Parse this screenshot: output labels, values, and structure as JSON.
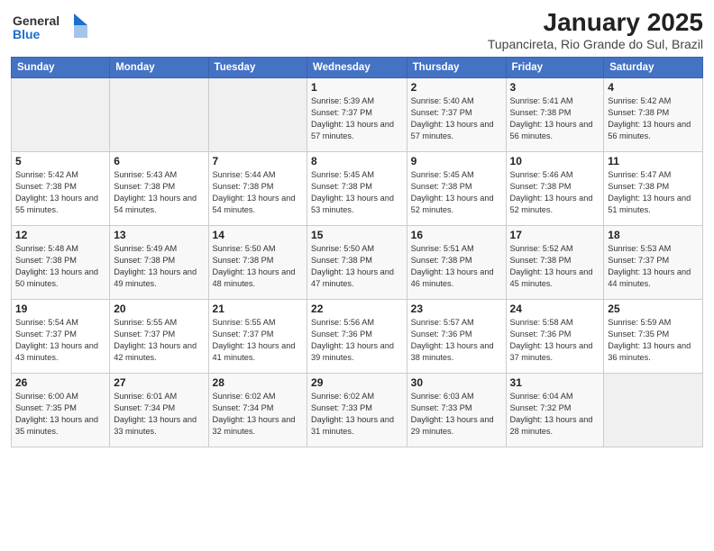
{
  "logo": {
    "general": "General",
    "blue": "Blue"
  },
  "header": {
    "title": "January 2025",
    "subtitle": "Tupancireta, Rio Grande do Sul, Brazil"
  },
  "weekdays": [
    "Sunday",
    "Monday",
    "Tuesday",
    "Wednesday",
    "Thursday",
    "Friday",
    "Saturday"
  ],
  "weeks": [
    [
      {
        "day": "",
        "content": ""
      },
      {
        "day": "",
        "content": ""
      },
      {
        "day": "",
        "content": ""
      },
      {
        "day": "1",
        "content": "Sunrise: 5:39 AM\nSunset: 7:37 PM\nDaylight: 13 hours\nand 57 minutes."
      },
      {
        "day": "2",
        "content": "Sunrise: 5:40 AM\nSunset: 7:37 PM\nDaylight: 13 hours\nand 57 minutes."
      },
      {
        "day": "3",
        "content": "Sunrise: 5:41 AM\nSunset: 7:38 PM\nDaylight: 13 hours\nand 56 minutes."
      },
      {
        "day": "4",
        "content": "Sunrise: 5:42 AM\nSunset: 7:38 PM\nDaylight: 13 hours\nand 56 minutes."
      }
    ],
    [
      {
        "day": "5",
        "content": "Sunrise: 5:42 AM\nSunset: 7:38 PM\nDaylight: 13 hours\nand 55 minutes."
      },
      {
        "day": "6",
        "content": "Sunrise: 5:43 AM\nSunset: 7:38 PM\nDaylight: 13 hours\nand 54 minutes."
      },
      {
        "day": "7",
        "content": "Sunrise: 5:44 AM\nSunset: 7:38 PM\nDaylight: 13 hours\nand 54 minutes."
      },
      {
        "day": "8",
        "content": "Sunrise: 5:45 AM\nSunset: 7:38 PM\nDaylight: 13 hours\nand 53 minutes."
      },
      {
        "day": "9",
        "content": "Sunrise: 5:45 AM\nSunset: 7:38 PM\nDaylight: 13 hours\nand 52 minutes."
      },
      {
        "day": "10",
        "content": "Sunrise: 5:46 AM\nSunset: 7:38 PM\nDaylight: 13 hours\nand 52 minutes."
      },
      {
        "day": "11",
        "content": "Sunrise: 5:47 AM\nSunset: 7:38 PM\nDaylight: 13 hours\nand 51 minutes."
      }
    ],
    [
      {
        "day": "12",
        "content": "Sunrise: 5:48 AM\nSunset: 7:38 PM\nDaylight: 13 hours\nand 50 minutes."
      },
      {
        "day": "13",
        "content": "Sunrise: 5:49 AM\nSunset: 7:38 PM\nDaylight: 13 hours\nand 49 minutes."
      },
      {
        "day": "14",
        "content": "Sunrise: 5:50 AM\nSunset: 7:38 PM\nDaylight: 13 hours\nand 48 minutes."
      },
      {
        "day": "15",
        "content": "Sunrise: 5:50 AM\nSunset: 7:38 PM\nDaylight: 13 hours\nand 47 minutes."
      },
      {
        "day": "16",
        "content": "Sunrise: 5:51 AM\nSunset: 7:38 PM\nDaylight: 13 hours\nand 46 minutes."
      },
      {
        "day": "17",
        "content": "Sunrise: 5:52 AM\nSunset: 7:38 PM\nDaylight: 13 hours\nand 45 minutes."
      },
      {
        "day": "18",
        "content": "Sunrise: 5:53 AM\nSunset: 7:37 PM\nDaylight: 13 hours\nand 44 minutes."
      }
    ],
    [
      {
        "day": "19",
        "content": "Sunrise: 5:54 AM\nSunset: 7:37 PM\nDaylight: 13 hours\nand 43 minutes."
      },
      {
        "day": "20",
        "content": "Sunrise: 5:55 AM\nSunset: 7:37 PM\nDaylight: 13 hours\nand 42 minutes."
      },
      {
        "day": "21",
        "content": "Sunrise: 5:55 AM\nSunset: 7:37 PM\nDaylight: 13 hours\nand 41 minutes."
      },
      {
        "day": "22",
        "content": "Sunrise: 5:56 AM\nSunset: 7:36 PM\nDaylight: 13 hours\nand 39 minutes."
      },
      {
        "day": "23",
        "content": "Sunrise: 5:57 AM\nSunset: 7:36 PM\nDaylight: 13 hours\nand 38 minutes."
      },
      {
        "day": "24",
        "content": "Sunrise: 5:58 AM\nSunset: 7:36 PM\nDaylight: 13 hours\nand 37 minutes."
      },
      {
        "day": "25",
        "content": "Sunrise: 5:59 AM\nSunset: 7:35 PM\nDaylight: 13 hours\nand 36 minutes."
      }
    ],
    [
      {
        "day": "26",
        "content": "Sunrise: 6:00 AM\nSunset: 7:35 PM\nDaylight: 13 hours\nand 35 minutes."
      },
      {
        "day": "27",
        "content": "Sunrise: 6:01 AM\nSunset: 7:34 PM\nDaylight: 13 hours\nand 33 minutes."
      },
      {
        "day": "28",
        "content": "Sunrise: 6:02 AM\nSunset: 7:34 PM\nDaylight: 13 hours\nand 32 minutes."
      },
      {
        "day": "29",
        "content": "Sunrise: 6:02 AM\nSunset: 7:33 PM\nDaylight: 13 hours\nand 31 minutes."
      },
      {
        "day": "30",
        "content": "Sunrise: 6:03 AM\nSunset: 7:33 PM\nDaylight: 13 hours\nand 29 minutes."
      },
      {
        "day": "31",
        "content": "Sunrise: 6:04 AM\nSunset: 7:32 PM\nDaylight: 13 hours\nand 28 minutes."
      },
      {
        "day": "",
        "content": ""
      }
    ]
  ]
}
